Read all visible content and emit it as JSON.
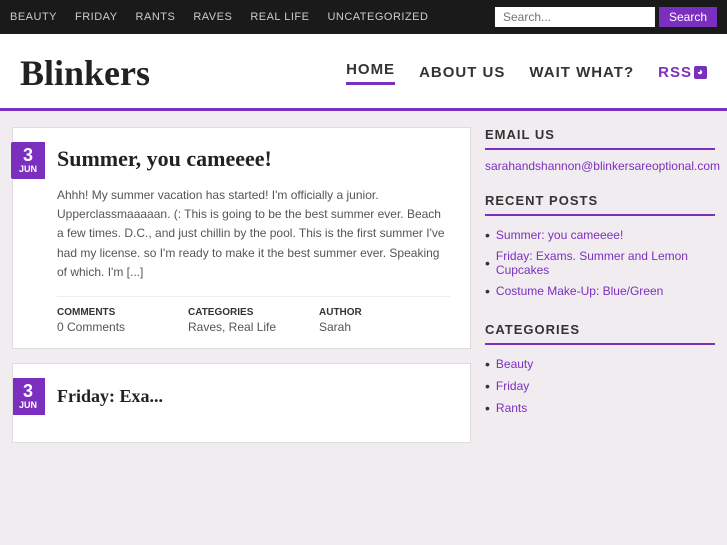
{
  "topnav": {
    "links": [
      {
        "label": "BEAUTY",
        "href": "#"
      },
      {
        "label": "FRIDAY",
        "href": "#"
      },
      {
        "label": "RANTS",
        "href": "#"
      },
      {
        "label": "RAVES",
        "href": "#"
      },
      {
        "label": "REAL LIFE",
        "href": "#"
      },
      {
        "label": "UNCATEGORIZED",
        "href": "#"
      }
    ],
    "search_placeholder": "Search...",
    "search_button": "Search"
  },
  "header": {
    "site_title": "Blinkers",
    "nav": [
      {
        "label": "HOME",
        "active": true
      },
      {
        "label": "ABOUT US",
        "active": false
      },
      {
        "label": "WAIT WHAT?",
        "active": false
      }
    ],
    "rss_label": "RSS"
  },
  "posts": [
    {
      "date_day": "3",
      "date_month": "JUN",
      "title": "Summer, you cameeee!",
      "excerpt": "Ahhh! My summer vacation has started! I'm officially a junior. Upperclassmaaaaan. (: This is going to be the best summer ever. Beach a few times. D.C., and just chillin by the pool. This is the first summer I've had my license. so I'm ready to make it the best summer ever. Speaking of which. I'm [...]",
      "meta": {
        "comments_label": "COMMENTS",
        "comments_value": "0 Comments",
        "categories_label": "CATEGORIES",
        "categories_value": "Raves, Real Life",
        "author_label": "AUTHOR",
        "author_value": "Sarah"
      }
    },
    {
      "date_day": "3",
      "date_month": "JUN",
      "title": "Friday: Exa...",
      "excerpt": "",
      "meta": {}
    }
  ],
  "sidebar": {
    "email_section": {
      "title": "EMAIL US",
      "email": "sarahandshannon@blinkersareoptional.com"
    },
    "recent_posts": {
      "title": "RECENT POSTS",
      "items": [
        {
          "label": "Summer: you cameeee!"
        },
        {
          "label": "Friday: Exams. Summer and Lemon Cupcakes"
        },
        {
          "label": "Costume Make-Up: Blue/Green"
        }
      ]
    },
    "categories": {
      "title": "CATEGORIES",
      "items": [
        {
          "label": "Beauty"
        },
        {
          "label": "Friday"
        },
        {
          "label": "Rants"
        }
      ]
    }
  }
}
